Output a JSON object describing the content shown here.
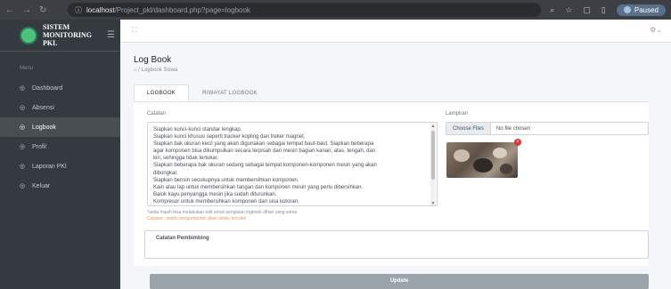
{
  "browser": {
    "url_host": "localhost",
    "url_path": "/Project_pkl/dashboard.php?page=logbook",
    "profile_status": "Paused"
  },
  "sidebar": {
    "brand_line1": "SISTEM",
    "brand_line2": "MONITORING PKL",
    "menu_header": "Menu",
    "items": [
      {
        "label": "Dashboard",
        "icon": "dashboard-icon"
      },
      {
        "label": "Absensi",
        "icon": "absensi-icon"
      },
      {
        "label": "Logbook",
        "icon": "logbook-icon",
        "active": true
      },
      {
        "label": "Profil",
        "icon": "profile-icon"
      },
      {
        "label": "Laporan PKl",
        "icon": "report-icon"
      },
      {
        "label": "Keluar",
        "icon": "logout-icon"
      }
    ]
  },
  "page": {
    "title": "Log Book",
    "breadcrumb": "/ Logbook Siswa"
  },
  "tabs": [
    {
      "label": "LOGBOOK",
      "active": true
    },
    {
      "label": "RIWAYAT LOGBOOK",
      "active": false
    }
  ],
  "form": {
    "catatan_label": "Catatan",
    "catatan_lines": [
      "Siapkan kunci-kunci standar lengkap.",
      "Siapkan kunci khusus seperti tracker kopling dan treker magnet.",
      "Siapkan bak ukuran kecil yang akan digunakan sebagai tempat baut-baut. Siapkan beberapa",
      "agar komponen bisa dikumpulkan secara terpisah dari mesin bagian kanan, atas, tengah, dan",
      "kiri, sehingga tidak tertukar.",
      "Siapkan beberapa bak ukuran sedang sebagai tempat komponen-komponen mesin yang akan",
      "dibongkar.",
      "Siapkan bensin secukupnya untuk membersihkan komponen.",
      "Kain atau lap untuk membersihkan tangan dan komponen mesin yang perlu dibersihkan.",
      "Balok kayu penyangga mesin jika sudah diturunkan.",
      "Kompresor untuk membersihkan komponen dari sisa kotoran."
    ],
    "hint_edit": "*anda masih bisa melakukan edit untuk pengisian logbook dihari yang sama",
    "hint_warning": "Catatan : waktu pengumpulan akan selalu tercatat",
    "lampiran_label": "Lampiran",
    "file_button": "Choose Files",
    "file_status": "No file chosen",
    "mentor_title": "Catatan Pembimbing",
    "update_button": "Update"
  }
}
